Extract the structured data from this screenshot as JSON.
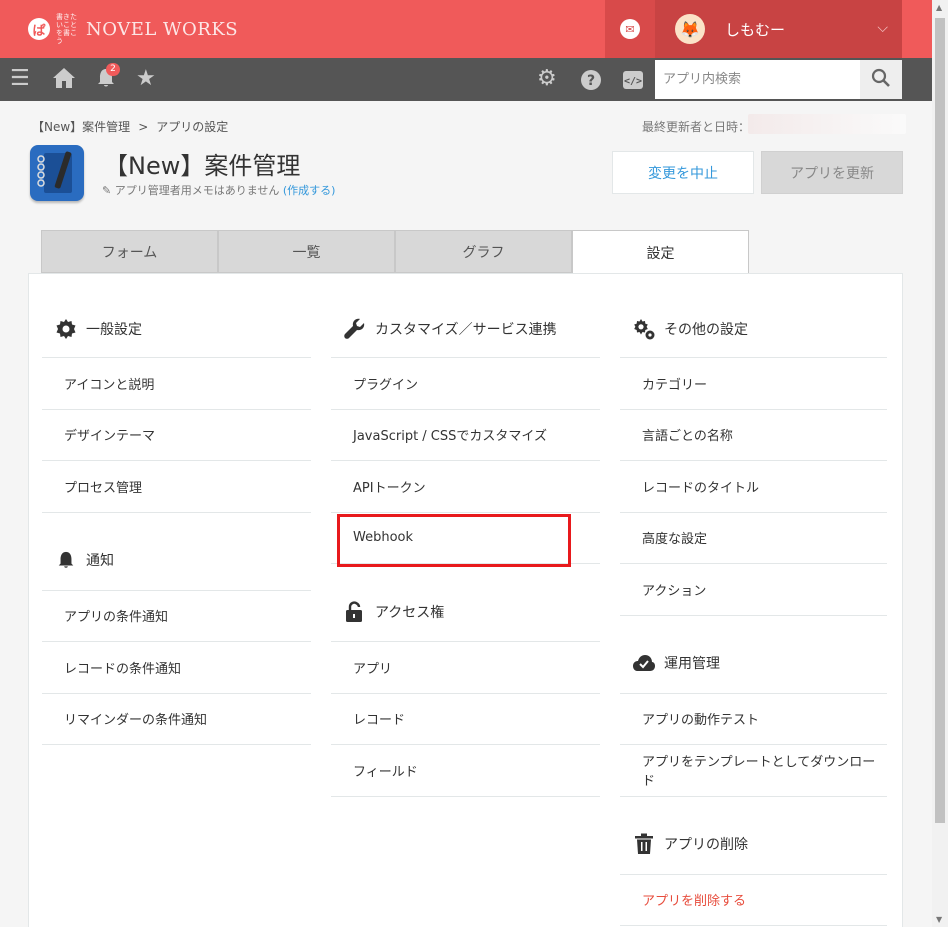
{
  "header": {
    "logo_mark": "ぱ",
    "logo_small": "書きたいことを書こう",
    "logo_name": "NOVEL WORKS",
    "user_name": "しもむー",
    "notification_count": "2",
    "search_placeholder": "アプリ内検索"
  },
  "breadcrumb": {
    "parent": "【New】案件管理",
    "separator": ">",
    "current": "アプリの設定"
  },
  "last_updated_label": "最終更新者と日時：",
  "app": {
    "title": "【New】案件管理",
    "memo_text": "アプリ管理者用メモはありません",
    "memo_link": "(作成する)"
  },
  "buttons": {
    "cancel": "変更を中止",
    "update": "アプリを更新"
  },
  "tabs": [
    {
      "label": "フォーム"
    },
    {
      "label": "一覧"
    },
    {
      "label": "グラフ"
    },
    {
      "label": "設定"
    }
  ],
  "columns": {
    "left": {
      "general": {
        "title": "一般設定",
        "items": [
          "アイコンと説明",
          "デザインテーマ",
          "プロセス管理"
        ]
      },
      "notify": {
        "title": "通知",
        "items": [
          "アプリの条件通知",
          "レコードの条件通知",
          "リマインダーの条件通知"
        ]
      }
    },
    "middle": {
      "custom": {
        "title": "カスタマイズ／サービス連携",
        "items": [
          "プラグイン",
          "JavaScript / CSSでカスタマイズ",
          "APIトークン",
          "Webhook"
        ]
      },
      "access": {
        "title": "アクセス権",
        "items": [
          "アプリ",
          "レコード",
          "フィールド"
        ]
      }
    },
    "right": {
      "other": {
        "title": "その他の設定",
        "items": [
          "カテゴリー",
          "言語ごとの名称",
          "レコードのタイトル",
          "高度な設定",
          "アクション"
        ]
      },
      "ops": {
        "title": "運用管理",
        "items": [
          "アプリの動作テスト",
          "アプリをテンプレートとしてダウンロード"
        ]
      },
      "delete": {
        "title": "アプリの削除",
        "items": [
          "アプリを削除する"
        ]
      }
    }
  },
  "colors": {
    "topbar": "#f05a5a",
    "navbar": "#555555",
    "link": "#3498db",
    "danger": "#e74c3c",
    "highlight": "#e8191c"
  }
}
